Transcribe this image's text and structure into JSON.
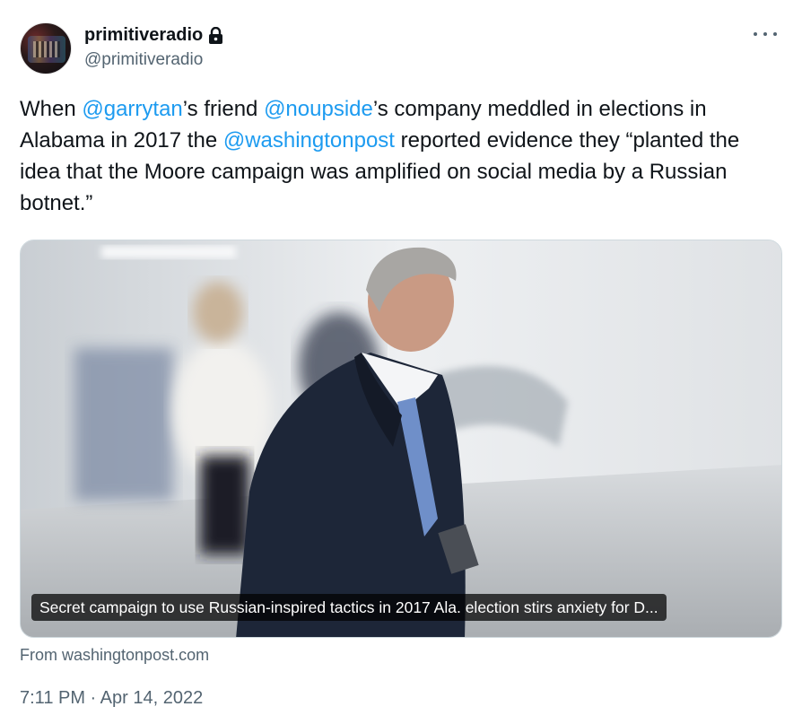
{
  "author": {
    "display_name": "primitiveradio",
    "handle": "@primitiveradio",
    "protected_icon": "lock-icon"
  },
  "tweet": {
    "segments": [
      {
        "text": "When ",
        "type": "text"
      },
      {
        "text": "@garrytan",
        "type": "mention"
      },
      {
        "text": "’s friend ",
        "type": "text"
      },
      {
        "text": "@noupside",
        "type": "mention"
      },
      {
        "text": "’s company meddled in elections in Alabama in 2017 the ",
        "type": "text"
      },
      {
        "text": "@washingtonpost",
        "type": "mention"
      },
      {
        "text": " reported evidence they “planted the idea that the Moore campaign was amplified on social media by a Russian botnet.”",
        "type": "text"
      }
    ]
  },
  "link_card": {
    "caption": "Secret campaign to use Russian-inspired tactics in 2017 Ala. election stirs anxiety for D...",
    "source": "From washingtonpost.com"
  },
  "meta": {
    "timestamp": "7:11 PM · Apr 14, 2022"
  },
  "icons": {
    "more": "more-icon",
    "lock": "lock-icon"
  },
  "colors": {
    "link": "#1d9bf0",
    "secondary_text": "#536471",
    "primary_text": "#0f1419"
  }
}
